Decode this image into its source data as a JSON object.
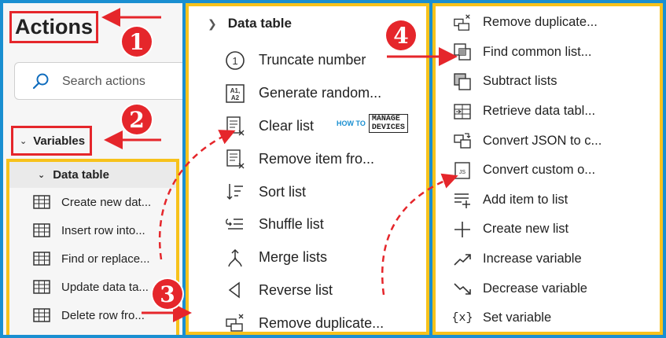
{
  "panel1": {
    "title": "Actions",
    "search_placeholder": "Search actions",
    "variables_label": "Variables",
    "data_table_label": "Data table",
    "items": [
      "Create new dat...",
      "Insert row into...",
      "Find or replace...",
      "Update data ta...",
      "Delete row fro..."
    ]
  },
  "panel2": {
    "header": "Data table",
    "items": [
      {
        "label": "Truncate number",
        "icon": "truncate-number-icon"
      },
      {
        "label": "Generate random...",
        "icon": "generate-random-icon"
      },
      {
        "label": "Clear list",
        "icon": "clear-list-icon"
      },
      {
        "label": "Remove item fro...",
        "icon": "remove-item-icon"
      },
      {
        "label": "Sort list",
        "icon": "sort-list-icon"
      },
      {
        "label": "Shuffle list",
        "icon": "shuffle-list-icon"
      },
      {
        "label": "Merge lists",
        "icon": "merge-lists-icon"
      },
      {
        "label": "Reverse list",
        "icon": "reverse-list-icon"
      },
      {
        "label": "Remove duplicate...",
        "icon": "remove-duplicate-icon"
      }
    ]
  },
  "panel3": {
    "items": [
      {
        "label": "Remove duplicate...",
        "icon": "remove-duplicate-icon"
      },
      {
        "label": "Find common list...",
        "icon": "find-common-list-icon"
      },
      {
        "label": "Subtract lists",
        "icon": "subtract-lists-icon"
      },
      {
        "label": "Retrieve data tabl...",
        "icon": "retrieve-data-table-icon"
      },
      {
        "label": "Convert JSON to c...",
        "icon": "convert-json-icon"
      },
      {
        "label": "Convert custom o...",
        "icon": "convert-custom-object-icon"
      },
      {
        "label": "Add item to list",
        "icon": "add-item-icon"
      },
      {
        "label": "Create new list",
        "icon": "create-new-list-icon"
      },
      {
        "label": "Increase variable",
        "icon": "increase-variable-icon"
      },
      {
        "label": "Decrease variable",
        "icon": "decrease-variable-icon"
      },
      {
        "label": "Set variable",
        "icon": "set-variable-icon"
      }
    ]
  },
  "badges": [
    "1",
    "2",
    "3",
    "4"
  ],
  "watermark": {
    "how_to": "HOW TO",
    "manage": "MANAGE",
    "devices": "DEVICES"
  },
  "colors": {
    "frame": "#1a8fd1",
    "highlight": "#f7c21b",
    "annotation": "#e5262b",
    "accent": "#0f6cbd"
  }
}
